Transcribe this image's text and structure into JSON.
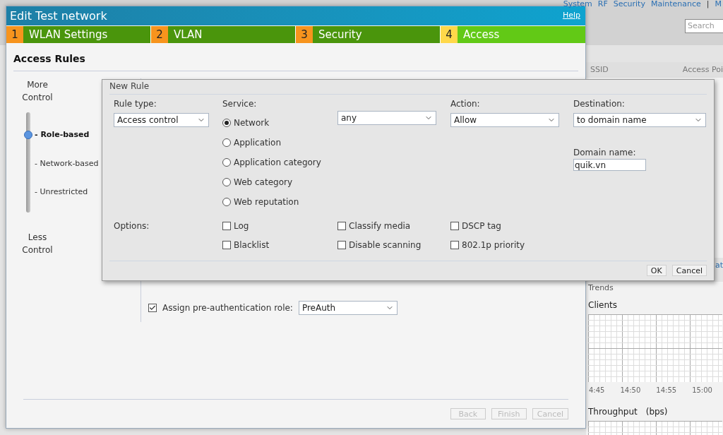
{
  "top_nav": {
    "links": [
      "System",
      "RF",
      "Security",
      "Maintenance"
    ],
    "separator": "|",
    "cut_link": "M"
  },
  "search": {
    "placeholder": "Search"
  },
  "background_table": {
    "columns": [
      "SSID",
      "Access Poi"
    ]
  },
  "background_link": "at",
  "trends": {
    "title": "Trends",
    "clients_title": "Clients",
    "x_ticks": [
      "4:45",
      "14:50",
      "14:55",
      "15:00"
    ],
    "throughput_title": "Throughput",
    "throughput_unit": "(bps)"
  },
  "wizard": {
    "title": "Edit Test network",
    "help": "Help",
    "steps": [
      {
        "number": "1",
        "label": "WLAN Settings",
        "selected": false
      },
      {
        "number": "2",
        "label": "VLAN",
        "selected": false
      },
      {
        "number": "3",
        "label": "Security",
        "selected": false
      },
      {
        "number": "4",
        "label": "Access",
        "selected": true
      }
    ],
    "heading": "Access Rules",
    "more_control": "More Control",
    "less_control": "Less Control",
    "levels": [
      {
        "label": "Role-based",
        "selected": true
      },
      {
        "label": "Network-based",
        "selected": false
      },
      {
        "label": "Unrestricted",
        "selected": false
      }
    ],
    "level_prefix": "-",
    "preauth": {
      "checked": true,
      "label": "Assign pre-authentication role:",
      "value": "PreAuth"
    },
    "buttons": [
      {
        "label": "Back",
        "disabled": true
      },
      {
        "label": "Finish",
        "disabled": true
      },
      {
        "label": "Cancel",
        "disabled": true
      }
    ]
  },
  "new_rule": {
    "title": "New Rule",
    "rule_type": {
      "label": "Rule type:",
      "value": "Access control"
    },
    "service": {
      "label": "Service:",
      "options": [
        {
          "label": "Network",
          "selected": true
        },
        {
          "label": "Application",
          "selected": false
        },
        {
          "label": "Application category",
          "selected": false
        },
        {
          "label": "Web category",
          "selected": false
        },
        {
          "label": "Web reputation",
          "selected": false
        }
      ],
      "value": "any"
    },
    "action": {
      "label": "Action:",
      "value": "Allow"
    },
    "destination": {
      "label": "Destination:",
      "value": "to domain name"
    },
    "domain_name": {
      "label": "Domain name:",
      "value": "quik.vn"
    },
    "options_label": "Options:",
    "options": [
      {
        "label": "Log",
        "checked": false
      },
      {
        "label": "Blacklist",
        "checked": false
      },
      {
        "label": "Classify media",
        "checked": false
      },
      {
        "label": "Disable scanning",
        "checked": false
      },
      {
        "label": "DSCP tag",
        "checked": false
      },
      {
        "label": "802.1p priority",
        "checked": false
      }
    ],
    "buttons": [
      "OK",
      "Cancel"
    ]
  }
}
